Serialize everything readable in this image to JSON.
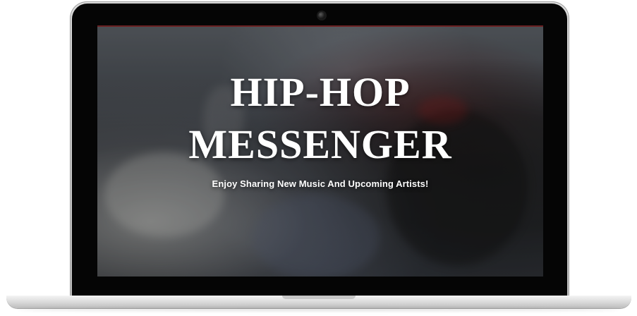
{
  "hero": {
    "title_line_1": "HIP-HOP",
    "title_line_2": "MESSENGER",
    "subtitle": "Enjoy Sharing New Music And Upcoming Artists!"
  },
  "colors": {
    "text": "#ffffff",
    "accent": "#8a1f1f",
    "device_bezel": "#050505",
    "device_frame": "#bdbdbd"
  }
}
